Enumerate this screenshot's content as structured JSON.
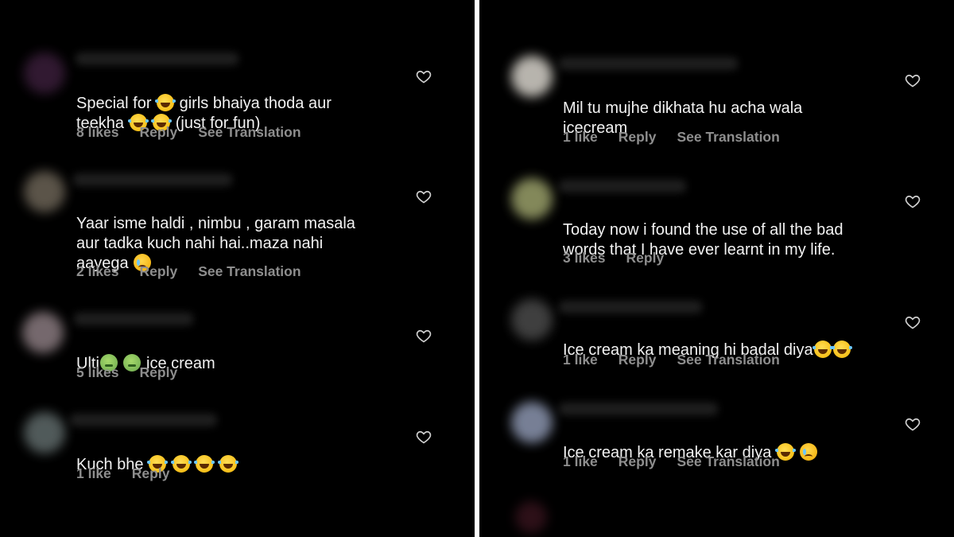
{
  "colors": {
    "background": "#000000",
    "divider": "#ffffff",
    "comment_text": "#f2f2f2",
    "meta_text": "#8e8e8e"
  },
  "left": {
    "comments": [
      {
        "line1": "Special for",
        "line1_after": " girls bhaiya thoda aur",
        "line2": "teekha",
        "line2_after": " (just for fun)",
        "likes": "8 likes",
        "reply": "Reply",
        "translate": "See Translation"
      },
      {
        "text": "Yaar isme haldi , nimbu , garam masala\naur tadka kuch nahi hai..maza nahi\naayega",
        "likes": "2 likes",
        "reply": "Reply",
        "translate": "See Translation"
      },
      {
        "pre": "Ulti",
        "post": " ice cream",
        "likes": "5 likes",
        "reply": "Reply"
      },
      {
        "pre": "Kuch bhe ",
        "likes": "1 like",
        "reply": "Reply"
      }
    ]
  },
  "right": {
    "comments": [
      {
        "text": "Mil tu mujhe dikhata hu acha wala\nicecream",
        "likes": "1 like",
        "reply": "Reply",
        "translate": "See Translation"
      },
      {
        "text": "Today now i found the use of all the bad\nwords that I have ever learnt in my life.",
        "likes": "3 likes",
        "reply": "Reply"
      },
      {
        "pre": "Ice cream ka meaning hi badal diya",
        "likes": "1 like",
        "reply": "Reply",
        "translate": "See Translation"
      },
      {
        "pre": "Ice cream ka remake kar diya ",
        "likes": "1 like",
        "reply": "Reply",
        "translate": "See Translation"
      }
    ]
  },
  "icons": {
    "heart": "heart-outline-icon",
    "laugh": "face-with-tears-of-joy-icon",
    "sad": "crying-face-icon",
    "sick": "nauseated-face-icon"
  }
}
